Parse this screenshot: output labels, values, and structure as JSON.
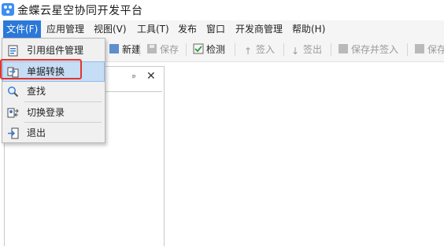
{
  "app": {
    "title": "金蝶云星空协同开发平台"
  },
  "menubar": {
    "items": [
      "文件(F)",
      "应用管理",
      "视图(V)",
      "工具(T)",
      "发布",
      "窗口",
      "开发商管理",
      "帮助(H)"
    ]
  },
  "toolbar": {
    "new_label": "新建",
    "save_label": "保存",
    "check_label": "检测",
    "checkin_label": "签入",
    "checkout_label": "签出",
    "save_checkin_label": "保存并签入",
    "save_partial_label": "保存"
  },
  "file_menu": {
    "items": [
      "引用组件管理",
      "单据转换",
      "查找",
      "切换登录",
      "退出"
    ]
  },
  "panel": {
    "pin_glyph": "ᵖ",
    "close_glyph": "✕"
  },
  "colors": {
    "menu_active": "#2b78d8",
    "hover_item": "#c6ddf6",
    "highlight_border": "#e5342b"
  }
}
